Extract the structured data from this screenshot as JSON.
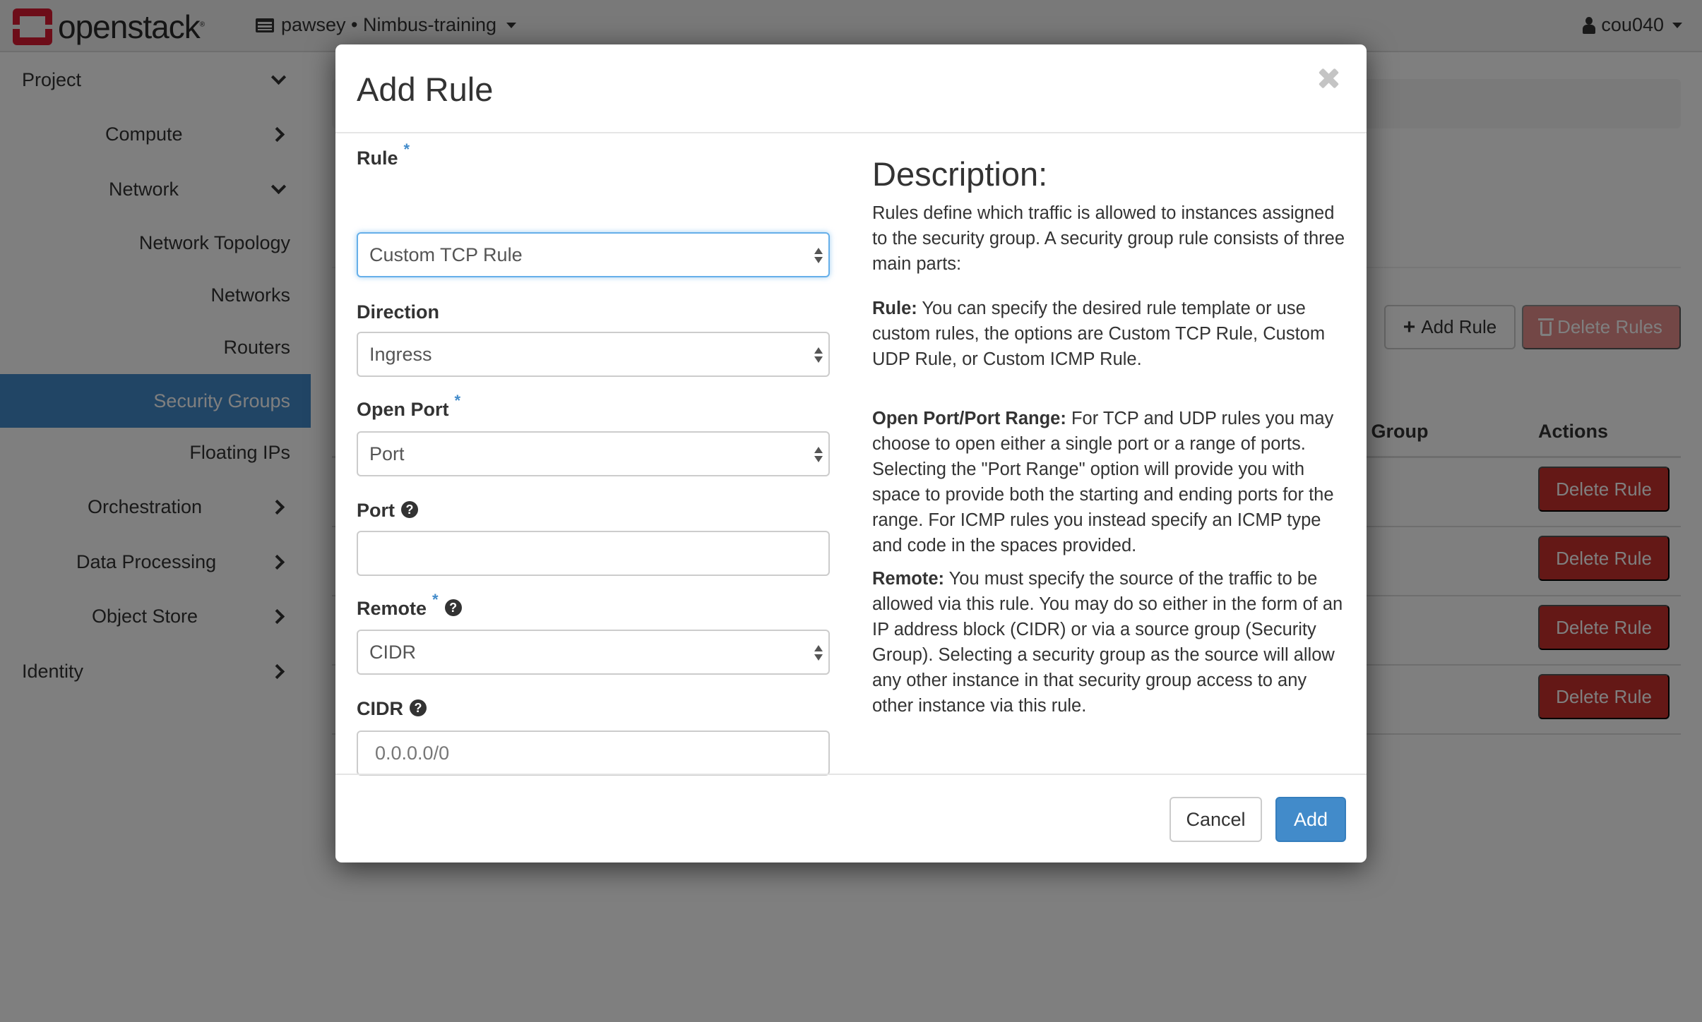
{
  "header": {
    "logo_text": "openstack",
    "logo_mark": "®",
    "project_picker": "pawsey • Nimbus-training",
    "user_menu": "cou040",
    "brand_color": "#da1a32"
  },
  "sidebar": {
    "items": [
      {
        "label": "Project",
        "level": 0,
        "chevron": "down"
      },
      {
        "label": "Compute",
        "level": 1,
        "chevron": "right"
      },
      {
        "label": "Network",
        "level": 1,
        "chevron": "down"
      },
      {
        "label": "Network Topology",
        "level": 2
      },
      {
        "label": "Networks",
        "level": 2
      },
      {
        "label": "Routers",
        "level": 2
      },
      {
        "label": "Security Groups",
        "level": 2,
        "active": true
      },
      {
        "label": "Floating IPs",
        "level": 2
      },
      {
        "label": "Orchestration",
        "level": 1,
        "chevron": "right"
      },
      {
        "label": "Data Processing",
        "level": 1,
        "chevron": "right"
      },
      {
        "label": "Object Store",
        "level": 1,
        "chevron": "right"
      },
      {
        "label": "Identity",
        "level": 0,
        "chevron": "right"
      }
    ],
    "active_color": "#428bca"
  },
  "main": {
    "add_rule_label": "Add Rule",
    "delete_rules_label": "Delete Rules",
    "table": {
      "visible_headers": [
        "ty Group",
        "Actions"
      ],
      "row_action_label": "Delete Rule",
      "row_count": 4
    }
  },
  "modal": {
    "title": "Add Rule",
    "fields": {
      "rule": {
        "label": "Rule",
        "required": true,
        "value": "Custom TCP Rule"
      },
      "direction": {
        "label": "Direction",
        "required": false,
        "value": "Ingress"
      },
      "open_port": {
        "label": "Open Port",
        "required": true,
        "value": "Port"
      },
      "port": {
        "label": "Port",
        "help": true,
        "value": "",
        "placeholder": ""
      },
      "remote": {
        "label": "Remote",
        "required": true,
        "help": true,
        "value": "CIDR"
      },
      "cidr": {
        "label": "CIDR",
        "help": true,
        "value": "",
        "placeholder": "0.0.0.0/0"
      }
    },
    "description": {
      "title": "Description:",
      "intro": "Rules define which traffic is allowed to instances assigned to the security group. A security group rule consists of three main parts:",
      "rule_term": "Rule:",
      "rule_text": " You can specify the desired rule template or use custom rules, the options are Custom TCP Rule, Custom UDP Rule, or Custom ICMP Rule.",
      "port_term": "Open Port/Port Range:",
      "port_text": " For TCP and UDP rules you may choose to open either a single port or a range of ports. Selecting the \"Port Range\" option will provide you with space to provide both the starting and ending ports for the range. For ICMP rules you instead specify an ICMP type and code in the spaces provided.",
      "remote_term": "Remote:",
      "remote_text": " You must specify the source of the traffic to be allowed via this rule. You may do so either in the form of an IP address block (CIDR) or via a source group (Security Group). Selecting a security group as the source will allow any other instance in that security group access to any other instance via this rule."
    },
    "cancel_label": "Cancel",
    "submit_label": "Add",
    "help_glyph": "?",
    "required_glyph": "*"
  }
}
